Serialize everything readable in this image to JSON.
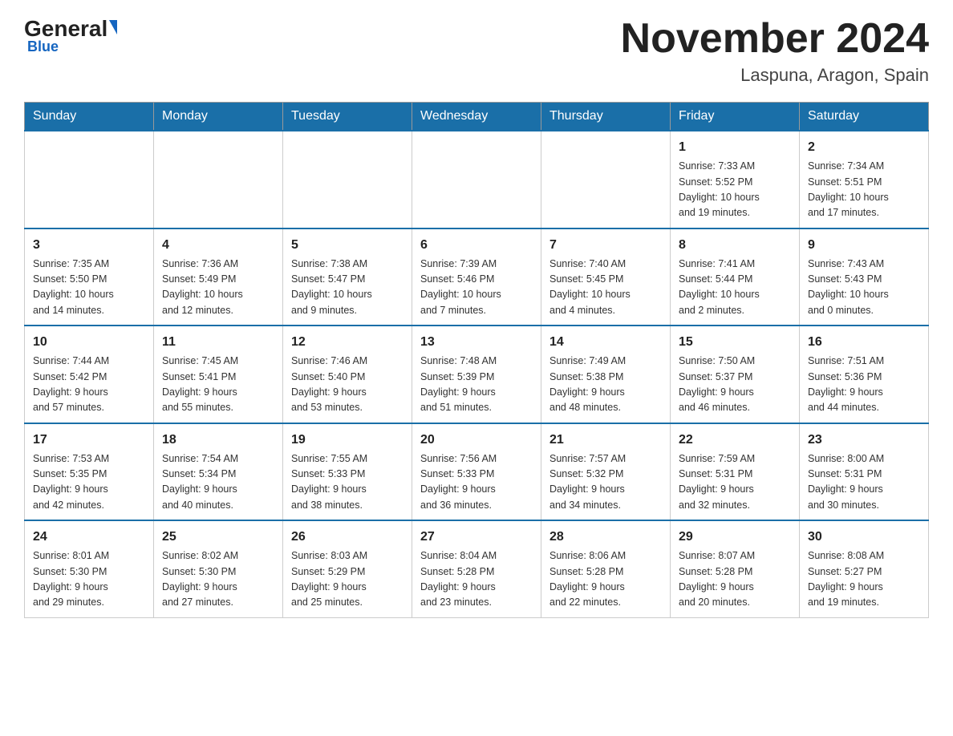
{
  "header": {
    "logo_general": "General",
    "logo_blue": "Blue",
    "month_title": "November 2024",
    "location": "Laspuna, Aragon, Spain"
  },
  "weekdays": [
    "Sunday",
    "Monday",
    "Tuesday",
    "Wednesday",
    "Thursday",
    "Friday",
    "Saturday"
  ],
  "weeks": [
    [
      {
        "day": "",
        "info": ""
      },
      {
        "day": "",
        "info": ""
      },
      {
        "day": "",
        "info": ""
      },
      {
        "day": "",
        "info": ""
      },
      {
        "day": "",
        "info": ""
      },
      {
        "day": "1",
        "info": "Sunrise: 7:33 AM\nSunset: 5:52 PM\nDaylight: 10 hours\nand 19 minutes."
      },
      {
        "day": "2",
        "info": "Sunrise: 7:34 AM\nSunset: 5:51 PM\nDaylight: 10 hours\nand 17 minutes."
      }
    ],
    [
      {
        "day": "3",
        "info": "Sunrise: 7:35 AM\nSunset: 5:50 PM\nDaylight: 10 hours\nand 14 minutes."
      },
      {
        "day": "4",
        "info": "Sunrise: 7:36 AM\nSunset: 5:49 PM\nDaylight: 10 hours\nand 12 minutes."
      },
      {
        "day": "5",
        "info": "Sunrise: 7:38 AM\nSunset: 5:47 PM\nDaylight: 10 hours\nand 9 minutes."
      },
      {
        "day": "6",
        "info": "Sunrise: 7:39 AM\nSunset: 5:46 PM\nDaylight: 10 hours\nand 7 minutes."
      },
      {
        "day": "7",
        "info": "Sunrise: 7:40 AM\nSunset: 5:45 PM\nDaylight: 10 hours\nand 4 minutes."
      },
      {
        "day": "8",
        "info": "Sunrise: 7:41 AM\nSunset: 5:44 PM\nDaylight: 10 hours\nand 2 minutes."
      },
      {
        "day": "9",
        "info": "Sunrise: 7:43 AM\nSunset: 5:43 PM\nDaylight: 10 hours\nand 0 minutes."
      }
    ],
    [
      {
        "day": "10",
        "info": "Sunrise: 7:44 AM\nSunset: 5:42 PM\nDaylight: 9 hours\nand 57 minutes."
      },
      {
        "day": "11",
        "info": "Sunrise: 7:45 AM\nSunset: 5:41 PM\nDaylight: 9 hours\nand 55 minutes."
      },
      {
        "day": "12",
        "info": "Sunrise: 7:46 AM\nSunset: 5:40 PM\nDaylight: 9 hours\nand 53 minutes."
      },
      {
        "day": "13",
        "info": "Sunrise: 7:48 AM\nSunset: 5:39 PM\nDaylight: 9 hours\nand 51 minutes."
      },
      {
        "day": "14",
        "info": "Sunrise: 7:49 AM\nSunset: 5:38 PM\nDaylight: 9 hours\nand 48 minutes."
      },
      {
        "day": "15",
        "info": "Sunrise: 7:50 AM\nSunset: 5:37 PM\nDaylight: 9 hours\nand 46 minutes."
      },
      {
        "day": "16",
        "info": "Sunrise: 7:51 AM\nSunset: 5:36 PM\nDaylight: 9 hours\nand 44 minutes."
      }
    ],
    [
      {
        "day": "17",
        "info": "Sunrise: 7:53 AM\nSunset: 5:35 PM\nDaylight: 9 hours\nand 42 minutes."
      },
      {
        "day": "18",
        "info": "Sunrise: 7:54 AM\nSunset: 5:34 PM\nDaylight: 9 hours\nand 40 minutes."
      },
      {
        "day": "19",
        "info": "Sunrise: 7:55 AM\nSunset: 5:33 PM\nDaylight: 9 hours\nand 38 minutes."
      },
      {
        "day": "20",
        "info": "Sunrise: 7:56 AM\nSunset: 5:33 PM\nDaylight: 9 hours\nand 36 minutes."
      },
      {
        "day": "21",
        "info": "Sunrise: 7:57 AM\nSunset: 5:32 PM\nDaylight: 9 hours\nand 34 minutes."
      },
      {
        "day": "22",
        "info": "Sunrise: 7:59 AM\nSunset: 5:31 PM\nDaylight: 9 hours\nand 32 minutes."
      },
      {
        "day": "23",
        "info": "Sunrise: 8:00 AM\nSunset: 5:31 PM\nDaylight: 9 hours\nand 30 minutes."
      }
    ],
    [
      {
        "day": "24",
        "info": "Sunrise: 8:01 AM\nSunset: 5:30 PM\nDaylight: 9 hours\nand 29 minutes."
      },
      {
        "day": "25",
        "info": "Sunrise: 8:02 AM\nSunset: 5:30 PM\nDaylight: 9 hours\nand 27 minutes."
      },
      {
        "day": "26",
        "info": "Sunrise: 8:03 AM\nSunset: 5:29 PM\nDaylight: 9 hours\nand 25 minutes."
      },
      {
        "day": "27",
        "info": "Sunrise: 8:04 AM\nSunset: 5:28 PM\nDaylight: 9 hours\nand 23 minutes."
      },
      {
        "day": "28",
        "info": "Sunrise: 8:06 AM\nSunset: 5:28 PM\nDaylight: 9 hours\nand 22 minutes."
      },
      {
        "day": "29",
        "info": "Sunrise: 8:07 AM\nSunset: 5:28 PM\nDaylight: 9 hours\nand 20 minutes."
      },
      {
        "day": "30",
        "info": "Sunrise: 8:08 AM\nSunset: 5:27 PM\nDaylight: 9 hours\nand 19 minutes."
      }
    ]
  ]
}
